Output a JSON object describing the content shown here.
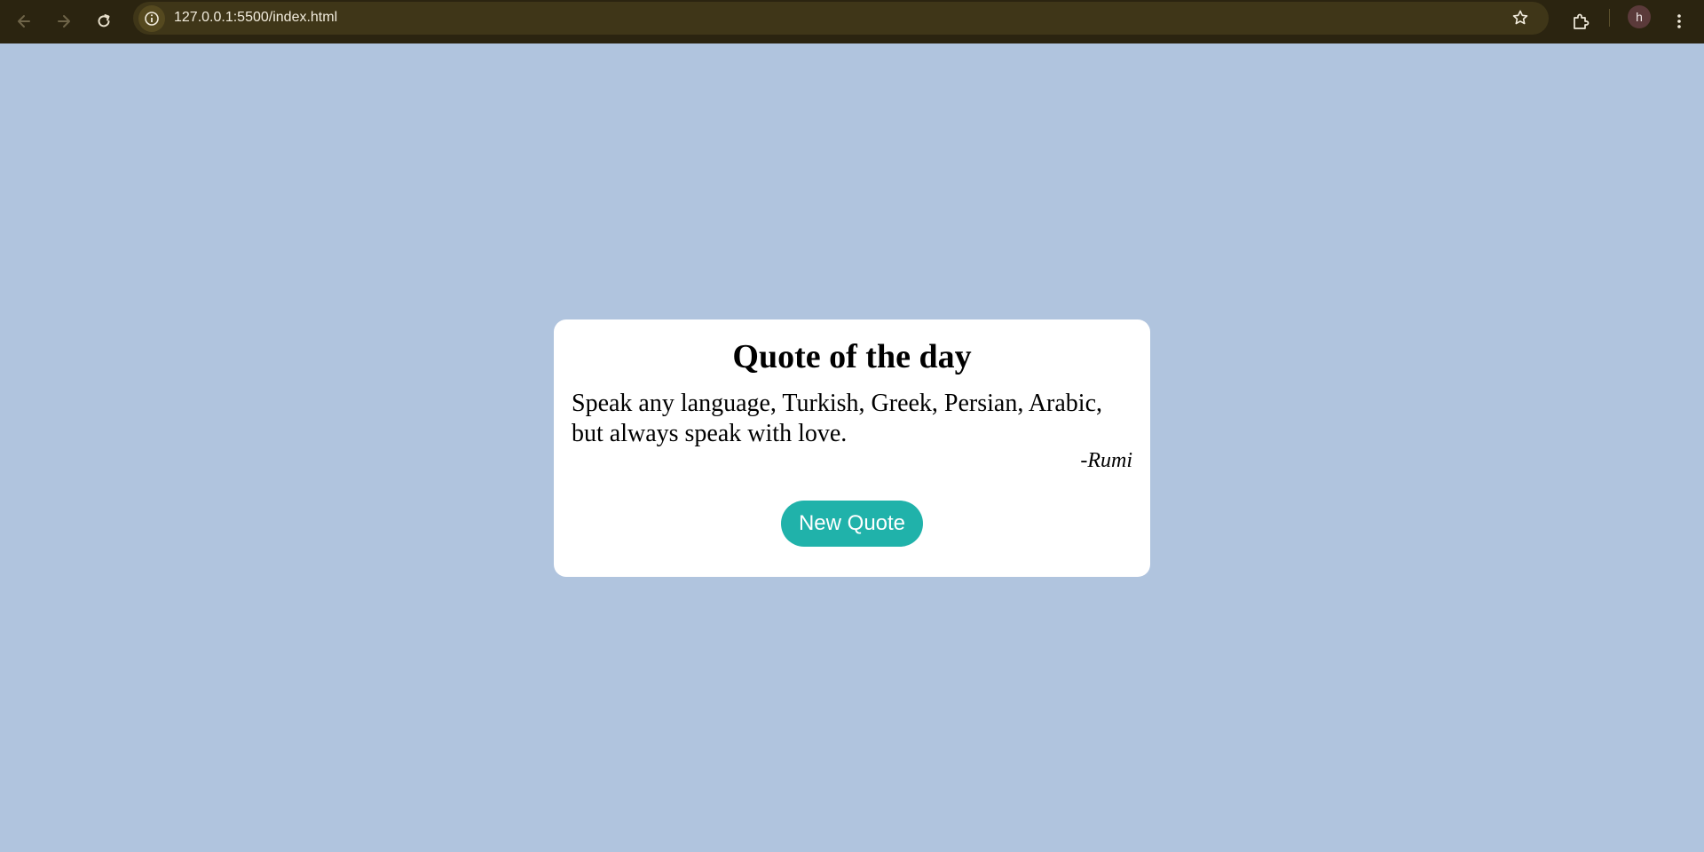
{
  "browser": {
    "url": "127.0.0.1:5500/index.html",
    "profile_initial": "h",
    "icons": {
      "back": "back-arrow-icon",
      "forward": "forward-arrow-icon",
      "reload": "reload-icon",
      "site_info": "info-icon",
      "bookmark": "star-icon",
      "extensions": "puzzle-icon",
      "menu": "kebab-menu-icon"
    },
    "colors": {
      "toolbar": "#2b2410",
      "address_bar": "#3f3618"
    }
  },
  "page": {
    "background_color": "#b0c4de"
  },
  "quote_card": {
    "title": "Quote of the day",
    "quote": "Speak any language, Turkish, Greek, Persian, Arabic, but always speak with love.",
    "author": "-Rumi",
    "button_label": "New Quote",
    "button_color": "#20b2aa"
  }
}
